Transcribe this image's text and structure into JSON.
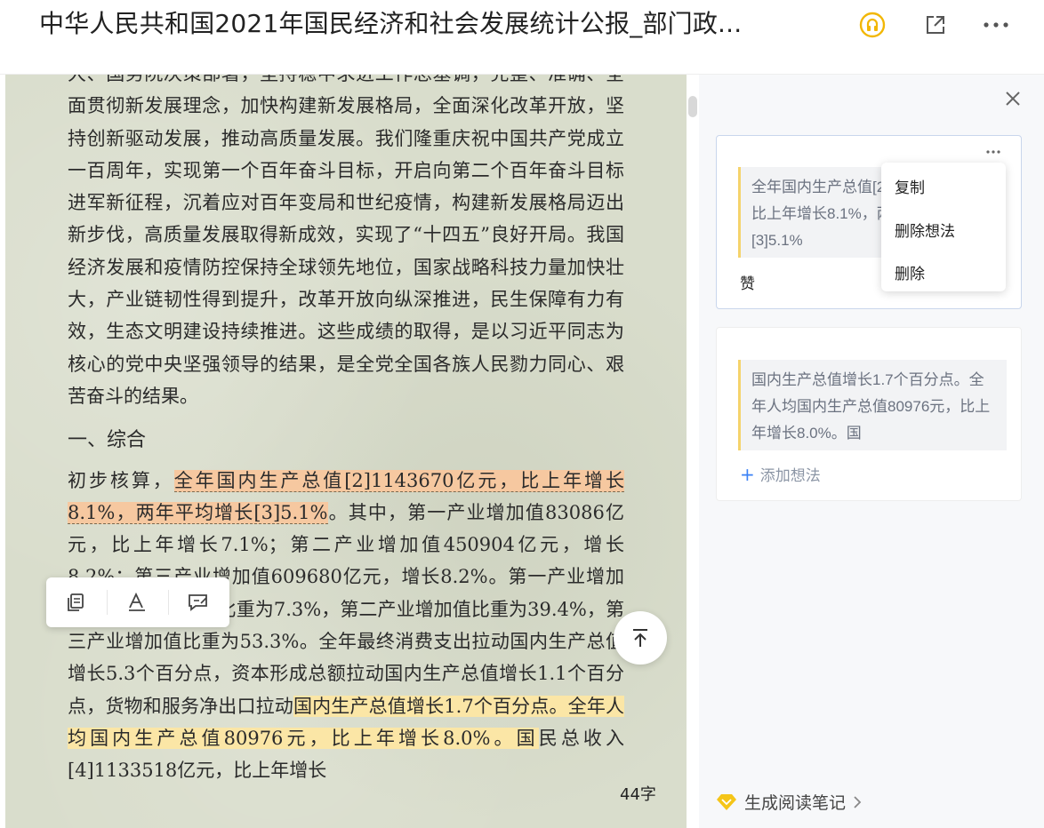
{
  "header": {
    "title": "中华人民共和国2021年国民经济和社会发展统计公报_部门政...",
    "icons": [
      "audio-icon",
      "share-icon",
      "more-icon"
    ]
  },
  "reader": {
    "paragraph_top": "大、国务院决策部署，坚持稳中求进工作总基调，完整、准确、全面贯彻新发展理念，加快构建新发展格局，全面深化改革开放，坚持创新驱动发展，推动高质量发展。我们隆重庆祝中国共产党成立一百周年，实现第一个百年奋斗目标，开启向第二个百年奋斗目标进军新征程，沉着应对百年变局和世纪疫情，构建新发展格局迈出新步伐，高质量发展取得新成效，实现了“十四五”良好开局。我国经济发展和疫情防控保持全球领先地位，国家战略科技力量加快壮大，产业链韧性得到提升，改革开放向纵深推进，民生保障有力有效，生态文明建设持续推进。这些成绩的取得，是以习近平同志为核心的党中央坚强领导的结果，是全党全国各族人民勠力同心、艰苦奋斗的结果。",
    "section_heading": "一、综合",
    "p2_start": "初步核算，",
    "p2_hl1": "全年国内生产总值[2]1143670亿元，比上年增长8.1%，两年平均增长[3]5.1%",
    "p2_mid": "。其中，第一产业增加值83086亿元，比上年增长7.1%；第二产业增加值450904亿元，增长8.2%；第三产业增加值609680亿元，增长8.2%。第一产业增加值占国内生产总值比重为7.3%，第二产业增加值比重为39.4%，第三产业增加值比重为53.3%。全年最终消费支出拉动国内生产总值增长5.3个百分点，资本形成总额拉动国内生产总值增长1.1个百分点，货物和服务净出口拉动",
    "p2_hl2": "国内生产总值增长1.7个百分点。全年人均国内生产总值80976元，比上年增长8.0%。国",
    "p2_end": "民总收入[4]1133518亿元，比上年增长",
    "word_count": "44字",
    "colors": {
      "orange_highlight": "#f6c8a0",
      "yellow_highlight": "#fbe6a6"
    }
  },
  "toolbar": {
    "icons": [
      "copy-icon",
      "highlight-icon",
      "comment-icon"
    ]
  },
  "side_panel": {
    "note1": {
      "quote": "全年国内生产总值[2]1143670亿元，比上年增长8.1%，两年平均增长[3]5.1%",
      "like": "赞"
    },
    "note2": {
      "quote": "国内生产总值增长1.7个百分点。全年人均国内生产总值80976元，比上年增长8.0%。国",
      "add_note": "添加想法"
    },
    "context_menu": {
      "copy": "复制",
      "delete_note": "删除想法",
      "delete": "删除"
    },
    "generate_notes": "生成阅读笔记"
  }
}
